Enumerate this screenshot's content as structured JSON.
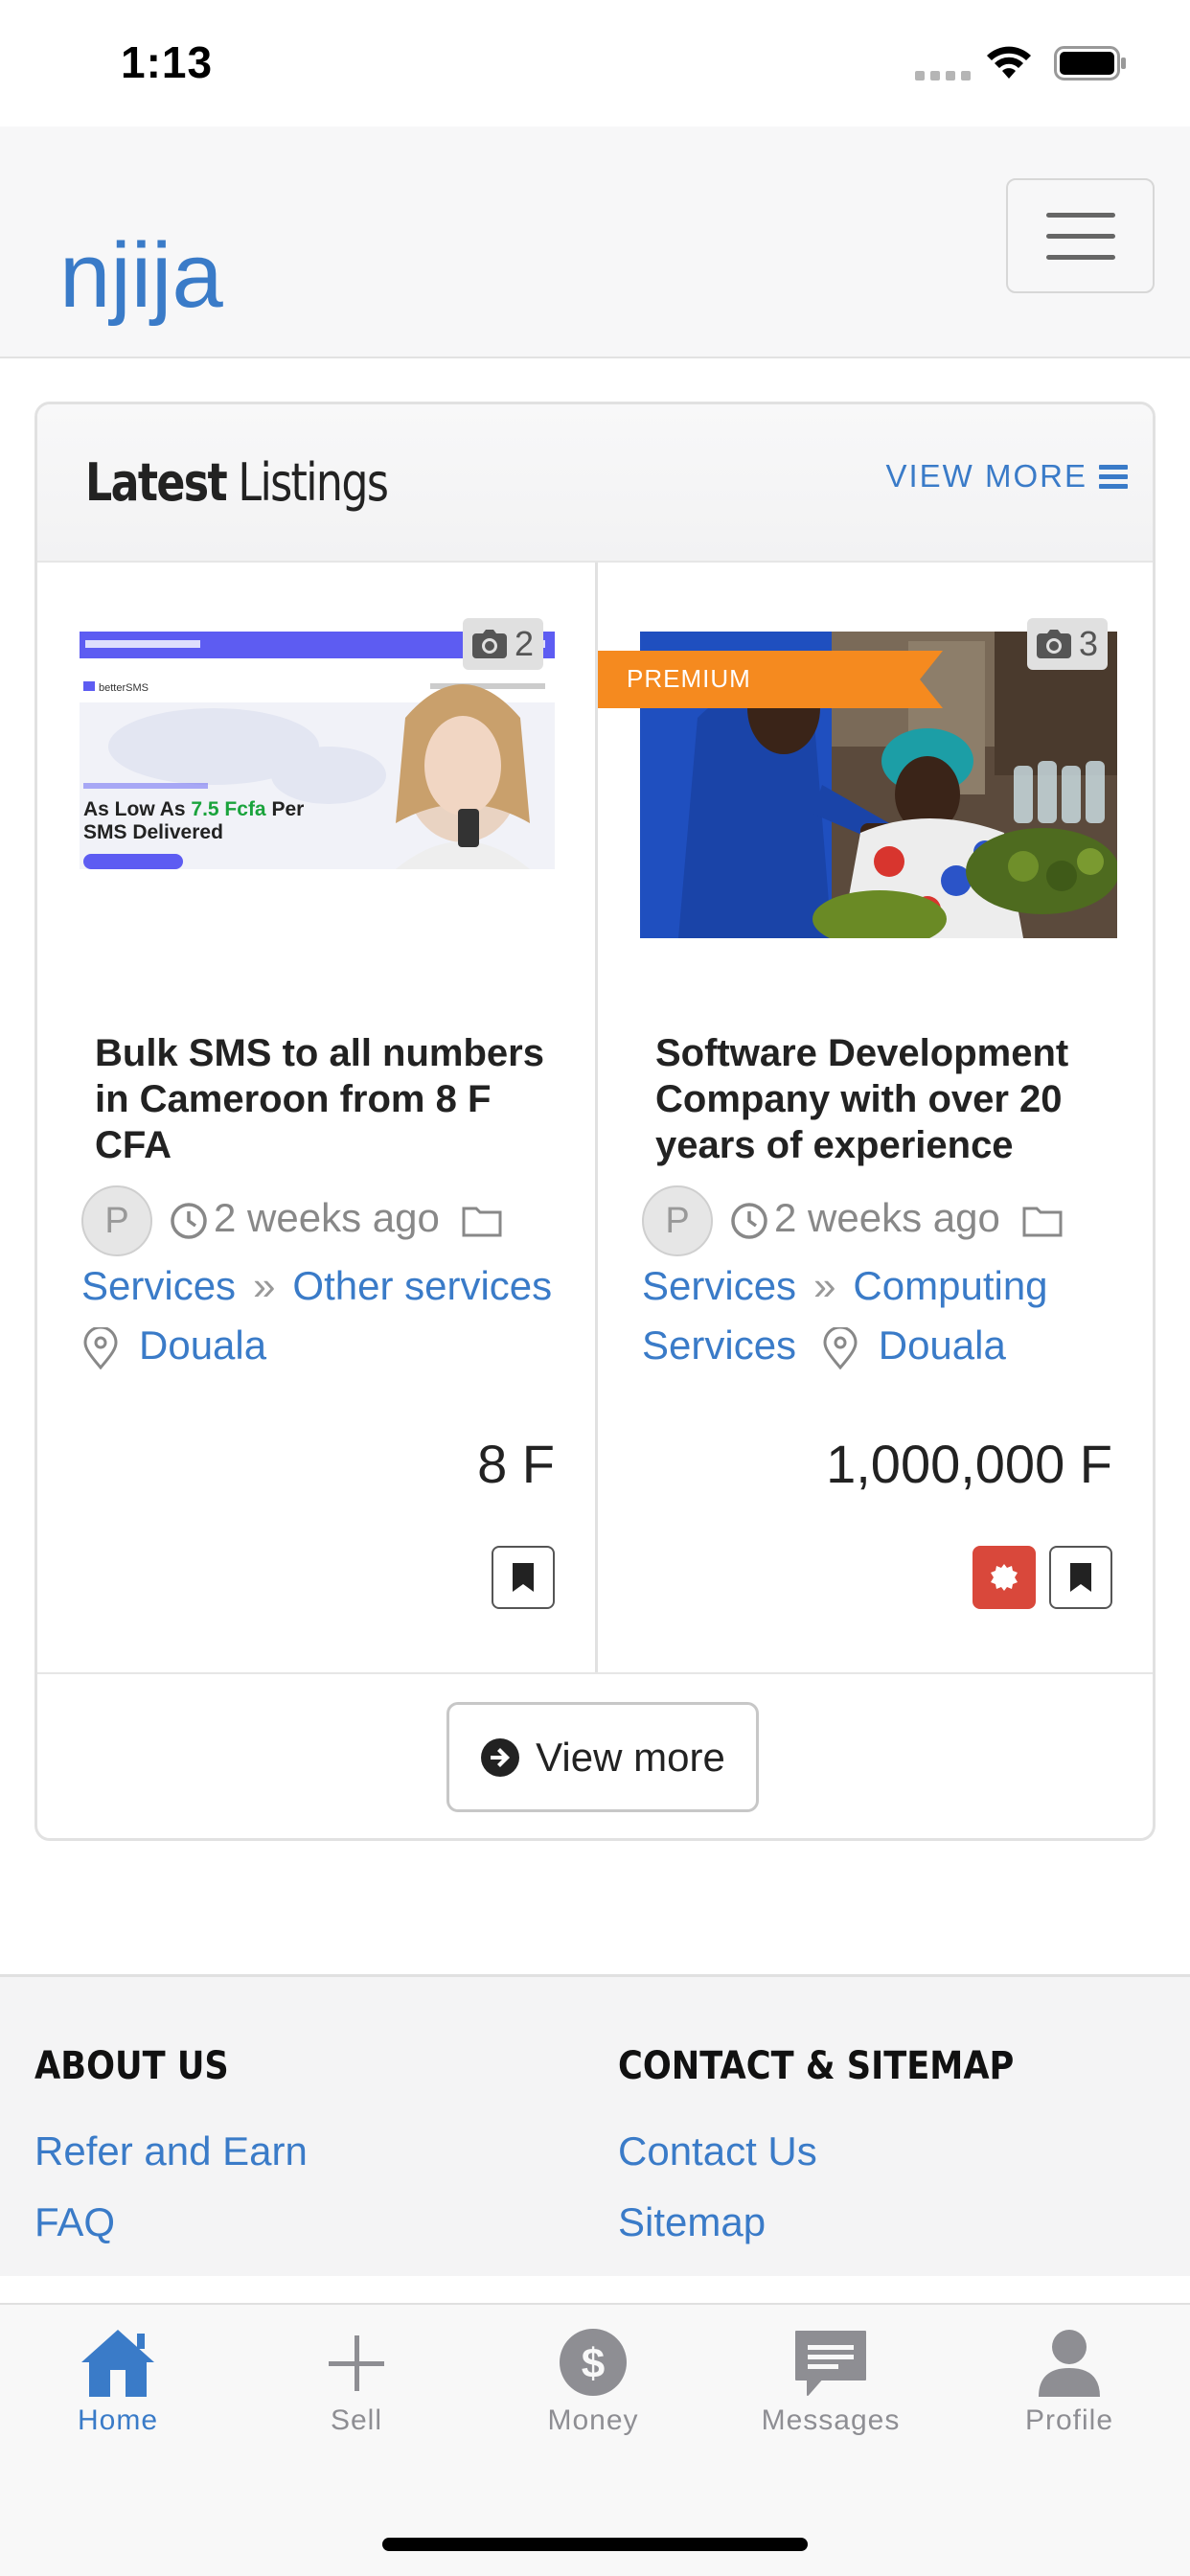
{
  "status_bar": {
    "time": "1:13"
  },
  "header": {
    "logo_text": "njija",
    "menu_icon": "hamburger-icon"
  },
  "latest": {
    "title_bold": "Latest",
    "title_light": "Listings",
    "view_more_label": "VIEW MORE",
    "view_more_button": "View more"
  },
  "listings": [
    {
      "title": "Bulk SMS to all numbers in Cameroon from 8 F CFA",
      "photo_count": "2",
      "premium": "",
      "avatar_letter": "P",
      "posted": "2 weeks ago",
      "category": "Services",
      "subcategory": "Other services",
      "location": "Douala",
      "price": "8 F",
      "thumb": {
        "brand": "betterSMS",
        "headline_1": "As Low As ",
        "headline_highlight": "7.5 Fcfa",
        "headline_2": " Per",
        "headline_3": "SMS Delivered"
      }
    },
    {
      "title": "Software Development Company with over 20 years of experience",
      "photo_count": "3",
      "premium": "PREMIUM",
      "avatar_letter": "P",
      "posted": "2 weeks ago",
      "category": "Services",
      "subcategory": "Computing Services",
      "location": "Douala",
      "price": "1,000,000 F"
    }
  ],
  "footer": {
    "about_heading": "ABOUT US",
    "about_links": [
      "Refer and Earn",
      "FAQ"
    ],
    "contact_heading": "CONTACT & SITEMAP",
    "contact_links": [
      "Contact Us",
      "Sitemap"
    ]
  },
  "tabbar": {
    "active": "Home",
    "items": [
      {
        "label": "Home",
        "icon": "home-icon"
      },
      {
        "label": "Sell",
        "icon": "plus-icon"
      },
      {
        "label": "Money",
        "icon": "dollar-icon"
      },
      {
        "label": "Messages",
        "icon": "message-icon"
      },
      {
        "label": "Profile",
        "icon": "person-icon"
      }
    ]
  },
  "colors": {
    "accent": "#3a7bc8",
    "premium": "#f58a1f",
    "danger": "#d9483b"
  }
}
